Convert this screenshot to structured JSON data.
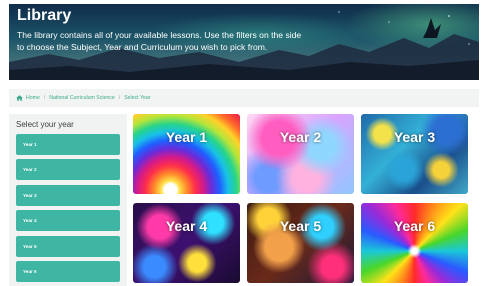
{
  "banner": {
    "title": "Library",
    "description": "The library contains all of your available lessons. Use the filters on the side to choose the Subject, Year and Curriculum you wish to pick from."
  },
  "breadcrumb": {
    "items": [
      "Home",
      "National Curriculum Science",
      "Select Year"
    ],
    "separator": "/"
  },
  "sidebar": {
    "title": "Select your year",
    "years": [
      "Year 1",
      "Year 2",
      "Year 3",
      "Year 4",
      "Year 5",
      "Year 6"
    ]
  },
  "tiles": [
    {
      "label": "Year 1"
    },
    {
      "label": "Year 2"
    },
    {
      "label": "Year 3"
    },
    {
      "label": "Year 4"
    },
    {
      "label": "Year 5"
    },
    {
      "label": "Year 6"
    }
  ],
  "colors": {
    "accent": "#3fb6a4",
    "breadcrumb_link": "#3aaa8c",
    "sidebar_bg": "#f1f3f3"
  },
  "icons": {
    "breadcrumb_home": "home-icon"
  }
}
